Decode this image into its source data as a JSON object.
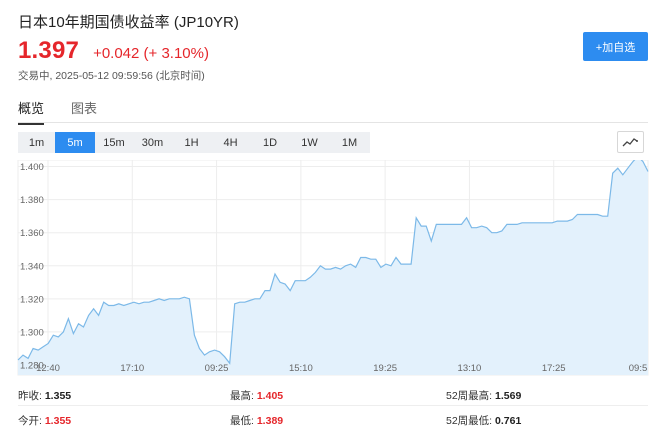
{
  "header": {
    "title": "日本10年期国债收益率 (JP10YR)",
    "price": "1.397",
    "change": "+0.042 (+ 3.10%)",
    "status": "交易中, 2025-05-12 09:59:56 (北京时间)"
  },
  "add_button": {
    "label": "+加自选"
  },
  "tabs": [
    {
      "label": "概览",
      "active": true
    },
    {
      "label": "图表",
      "active": false
    }
  ],
  "periods": [
    {
      "label": "1m",
      "active": false
    },
    {
      "label": "5m",
      "active": true
    },
    {
      "label": "15m",
      "active": false
    },
    {
      "label": "30m",
      "active": false
    },
    {
      "label": "1H",
      "active": false
    },
    {
      "label": "4H",
      "active": false
    },
    {
      "label": "1D",
      "active": false
    },
    {
      "label": "1W",
      "active": false
    },
    {
      "label": "1M",
      "active": false
    }
  ],
  "chart_type_icon": "line-chart-icon",
  "colors": {
    "accent": "#2d8cf0",
    "up": "#e5262b",
    "line": "#7cb9e8",
    "area": "#e3f1fc",
    "grid": "#ededed"
  },
  "chart_data": {
    "type": "area",
    "title": "",
    "xlabel": "",
    "ylabel": "",
    "ylim": [
      1.28,
      1.41
    ],
    "y_ticks": [
      "1.280",
      "1.300",
      "1.320",
      "1.340",
      "1.360",
      "1.380",
      "1.400"
    ],
    "x_ticks": [
      "12:40",
      "17:10",
      "09:25",
      "15:10",
      "19:25",
      "13:10",
      "17:25",
      "09:5"
    ],
    "grid": true,
    "legend": "none",
    "series": [
      {
        "values": [
          1.283,
          1.286,
          1.284,
          1.29,
          1.289,
          1.291,
          1.293,
          1.298,
          1.297,
          1.3,
          1.308,
          1.299,
          1.305,
          1.303,
          1.31,
          1.314,
          1.31,
          1.318,
          1.316,
          1.316,
          1.317,
          1.316,
          1.317,
          1.318,
          1.317,
          1.318,
          1.318,
          1.319,
          1.32,
          1.319,
          1.32,
          1.32,
          1.32,
          1.321,
          1.32,
          1.298,
          1.29,
          1.286,
          1.288,
          1.289,
          1.288,
          1.285,
          1.281,
          1.317,
          1.318,
          1.318,
          1.319,
          1.32,
          1.32,
          1.325,
          1.325,
          1.335,
          1.33,
          1.329,
          1.325,
          1.331,
          1.331,
          1.331,
          1.333,
          1.336,
          1.34,
          1.338,
          1.338,
          1.339,
          1.338,
          1.34,
          1.341,
          1.339,
          1.345,
          1.345,
          1.344,
          1.344,
          1.339,
          1.341,
          1.34,
          1.345,
          1.341,
          1.341,
          1.341,
          1.369,
          1.364,
          1.364,
          1.355,
          1.365,
          1.365,
          1.365,
          1.365,
          1.365,
          1.365,
          1.369,
          1.363,
          1.363,
          1.364,
          1.363,
          1.36,
          1.36,
          1.361,
          1.365,
          1.365,
          1.365,
          1.366,
          1.366,
          1.366,
          1.366,
          1.366,
          1.366,
          1.366,
          1.367,
          1.367,
          1.367,
          1.368,
          1.371,
          1.371,
          1.371,
          1.371,
          1.371,
          1.37,
          1.37,
          1.396,
          1.399,
          1.395,
          1.399,
          1.403,
          1.406,
          1.403,
          1.397
        ]
      }
    ]
  },
  "stats": [
    {
      "label": "昨收:",
      "value": "1.355",
      "red": false
    },
    {
      "label": "最高:",
      "value": "1.405",
      "red": true
    },
    {
      "label": "52周最高:",
      "value": "1.569",
      "red": false
    },
    {
      "label": "今开:",
      "value": "1.355",
      "red": true
    },
    {
      "label": "最低:",
      "value": "1.389",
      "red": true
    },
    {
      "label": "52周最低:",
      "value": "0.761",
      "red": false
    }
  ]
}
